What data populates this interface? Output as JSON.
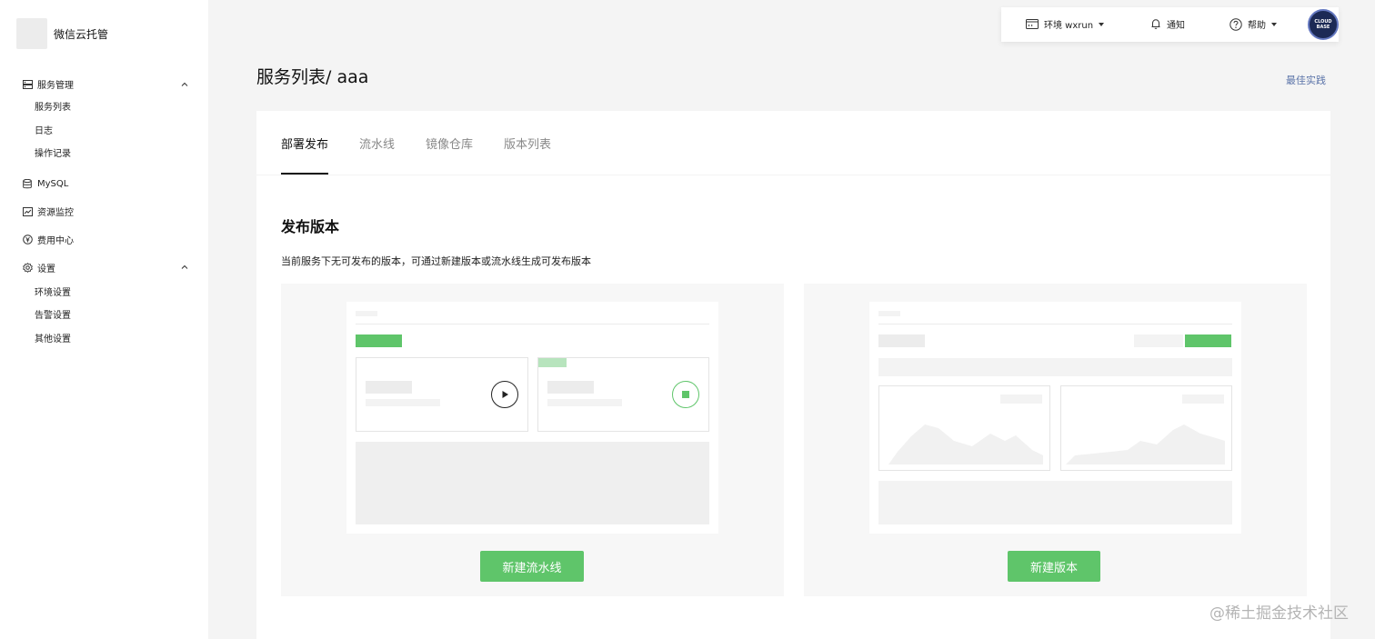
{
  "brand": {
    "name": "微信云托管"
  },
  "sidebar": {
    "groups": [
      {
        "label": "服务管理",
        "icon": "server-icon",
        "expanded": true,
        "items": [
          "服务列表",
          "日志",
          "操作记录"
        ]
      },
      {
        "label": "MySQL",
        "icon": "database-icon"
      },
      {
        "label": "资源监控",
        "icon": "monitor-icon"
      },
      {
        "label": "费用中心",
        "icon": "yuan-icon"
      },
      {
        "label": "设置",
        "icon": "gear-icon",
        "expanded": true,
        "items": [
          "环境设置",
          "告警设置",
          "其他设置"
        ]
      }
    ]
  },
  "topbar": {
    "env_label": "环境 wxrun",
    "notify_label": "通知",
    "help_label": "帮助",
    "avatar_text_1": "CLOUD",
    "avatar_text_2": "BASE"
  },
  "page": {
    "title": "服务列表/ aaa",
    "best_practice": "最佳实践"
  },
  "tabs": [
    {
      "label": "部署发布",
      "active": true
    },
    {
      "label": "流水线",
      "active": false
    },
    {
      "label": "镜像仓库",
      "active": false
    },
    {
      "label": "版本列表",
      "active": false
    }
  ],
  "section": {
    "title": "发布版本",
    "description": "当前服务下无可发布的版本，可通过新建版本或流水线生成可发布版本"
  },
  "actions": {
    "new_pipeline": "新建流水线",
    "new_version": "新建版本"
  },
  "watermark": "@稀土掘金技术社区",
  "colors": {
    "accent": "#5fc56a",
    "link": "#5a73a8"
  }
}
